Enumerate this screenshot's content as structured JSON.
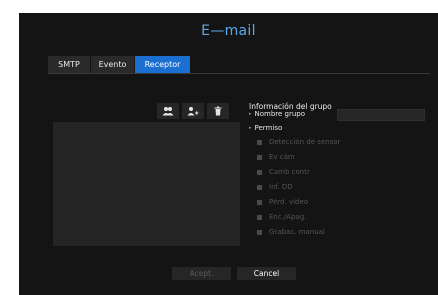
{
  "window": {
    "title": "E—mail"
  },
  "tabs": [
    {
      "label": "SMTP",
      "active": false
    },
    {
      "label": "Evento",
      "active": false
    },
    {
      "label": "Receptor",
      "active": true
    }
  ],
  "toolbar": {
    "icons": [
      "add-group-icon",
      "add-user-icon",
      "delete-icon"
    ]
  },
  "group_info": {
    "title": "Información del grupo",
    "name_label": "Nombre grupo",
    "name_value": "",
    "permission_label": "Permiso",
    "permissions": [
      {
        "label": "Detección de sensor",
        "checked": false,
        "enabled": false
      },
      {
        "label": "Ev cám",
        "checked": false,
        "enabled": false
      },
      {
        "label": "Camb contr",
        "checked": false,
        "enabled": false
      },
      {
        "label": "Inf. DD",
        "checked": false,
        "enabled": false
      },
      {
        "label": "Pérd. vídeo",
        "checked": false,
        "enabled": false
      },
      {
        "label": "Enc./Apag.",
        "checked": false,
        "enabled": false
      },
      {
        "label": "Grabac. manual",
        "checked": false,
        "enabled": false
      }
    ]
  },
  "footer": {
    "accept_label": "Acept.",
    "cancel_label": "Cancel"
  },
  "colors": {
    "accent": "#1b6fd1",
    "title": "#5fa8e8",
    "background": "#141414"
  }
}
